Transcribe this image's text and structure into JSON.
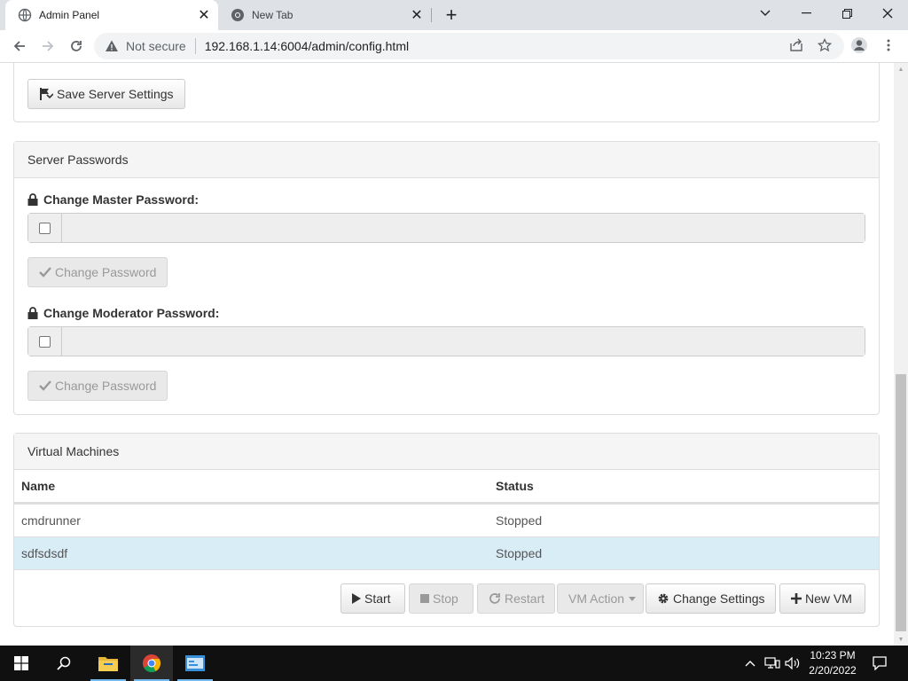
{
  "browser": {
    "tabs": [
      {
        "title": "Admin Panel",
        "active": true,
        "icon": "globe-icon"
      },
      {
        "title": "New Tab",
        "active": false,
        "icon": "chrome-icon"
      }
    ],
    "security_label": "Not secure",
    "url": "192.168.1.14:6004/admin/config.html"
  },
  "server_settings": {
    "save_label": "Save Server Settings",
    "save_icon": "save-flag-icon"
  },
  "server_passwords": {
    "heading": "Server Passwords",
    "master": {
      "label": "Change Master Password:",
      "checked": false,
      "value": "",
      "button_label": "Change Password"
    },
    "moderator": {
      "label": "Change Moderator Password:",
      "checked": false,
      "value": "",
      "button_label": "Change Password"
    }
  },
  "virtual_machines": {
    "heading": "Virtual Machines",
    "columns": [
      "Name",
      "Status"
    ],
    "rows": [
      {
        "name": "cmdrunner",
        "status": "Stopped",
        "selected": false
      },
      {
        "name": "sdfsdsdf",
        "status": "Stopped",
        "selected": true
      }
    ],
    "actions": {
      "start": "Start",
      "stop": "Stop",
      "restart": "Restart",
      "vm_action": "VM Action",
      "change_settings": "Change Settings",
      "new_vm": "New VM"
    }
  },
  "taskbar": {
    "time": "10:23 PM",
    "date": "2/20/2022"
  },
  "colors": {
    "selected_row": "#d9edf7",
    "panel_heading": "#f5f5f5",
    "taskbar": "#101010"
  }
}
